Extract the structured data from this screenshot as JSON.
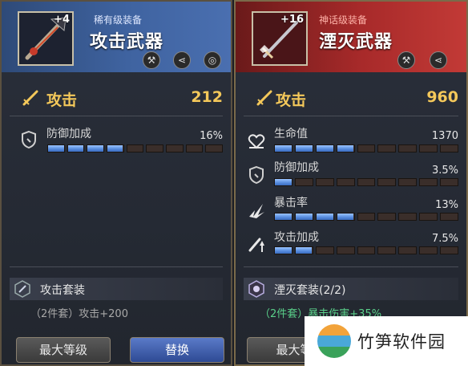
{
  "left": {
    "level": "+4",
    "grade": "稀有级装备",
    "title": "攻击武器",
    "attack_label": "攻击",
    "attack_value": "212",
    "stats": [
      {
        "icon": "shield-icon",
        "label": "防御加成",
        "value": "16%",
        "fill": 0.44
      }
    ],
    "set_name": "攻击套装",
    "set_bonus": "（2件套）攻击+200",
    "header_buttons": [
      "hammer-icon",
      "share-icon",
      "coin-icon"
    ]
  },
  "right": {
    "level": "+16",
    "grade": "神话级装备",
    "title": "湮灭武器",
    "attack_label": "攻击",
    "attack_value": "960",
    "stats": [
      {
        "icon": "heart-icon",
        "label": "生命值",
        "value": "1370",
        "fill": 0.44
      },
      {
        "icon": "shield-icon",
        "label": "防御加成",
        "value": "3.5%",
        "fill": 0.11
      },
      {
        "icon": "critical-icon",
        "label": "暴击率",
        "value": "13%",
        "fill": 0.44
      },
      {
        "icon": "attack-boost-icon",
        "label": "攻击加成",
        "value": "7.5%",
        "fill": 0.22
      }
    ],
    "set_name": "湮灭套装(2/2)",
    "set_bonus_prefix": "（2件套）",
    "set_bonus_effect": "暴击伤害+35%",
    "header_buttons": [
      "hammer-icon",
      "share-icon"
    ]
  },
  "buttons": {
    "max_level": "最大等级",
    "replace": "替换",
    "max_level_right": "最大等"
  },
  "watermark": "竹笋软件园",
  "colors": {
    "attack": "#f4c85a",
    "bar_fill": "#5a8fe0",
    "bonus_green": "#5ad08a"
  }
}
